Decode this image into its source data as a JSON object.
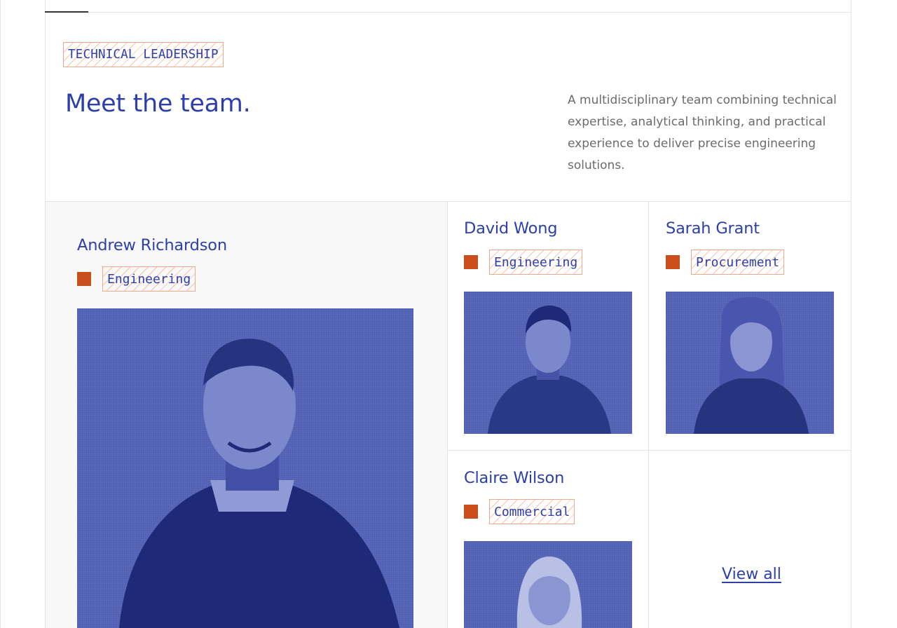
{
  "section": {
    "eyebrow": "TECHNICAL LEADERSHIP",
    "title": "Meet the team.",
    "intro": "A multidisciplinary team combining technical expertise, analytical thinking, and practical experience to deliver precise engineering solutions."
  },
  "team": [
    {
      "name": "Andrew Richardson",
      "role": "Engineering"
    },
    {
      "name": "David Wong",
      "role": "Engineering"
    },
    {
      "name": "Sarah Grant",
      "role": "Procurement"
    },
    {
      "name": "Claire Wilson",
      "role": "Commercial"
    }
  ],
  "view_all_label": "View all",
  "colors": {
    "brand_blue": "#2d3fa8",
    "photo_blue": "#5968ba",
    "accent_orange": "#c9501c",
    "tag_border": "#f0a98a",
    "text_grey": "#6b6b6b",
    "line_grey": "#e4e4e4"
  }
}
